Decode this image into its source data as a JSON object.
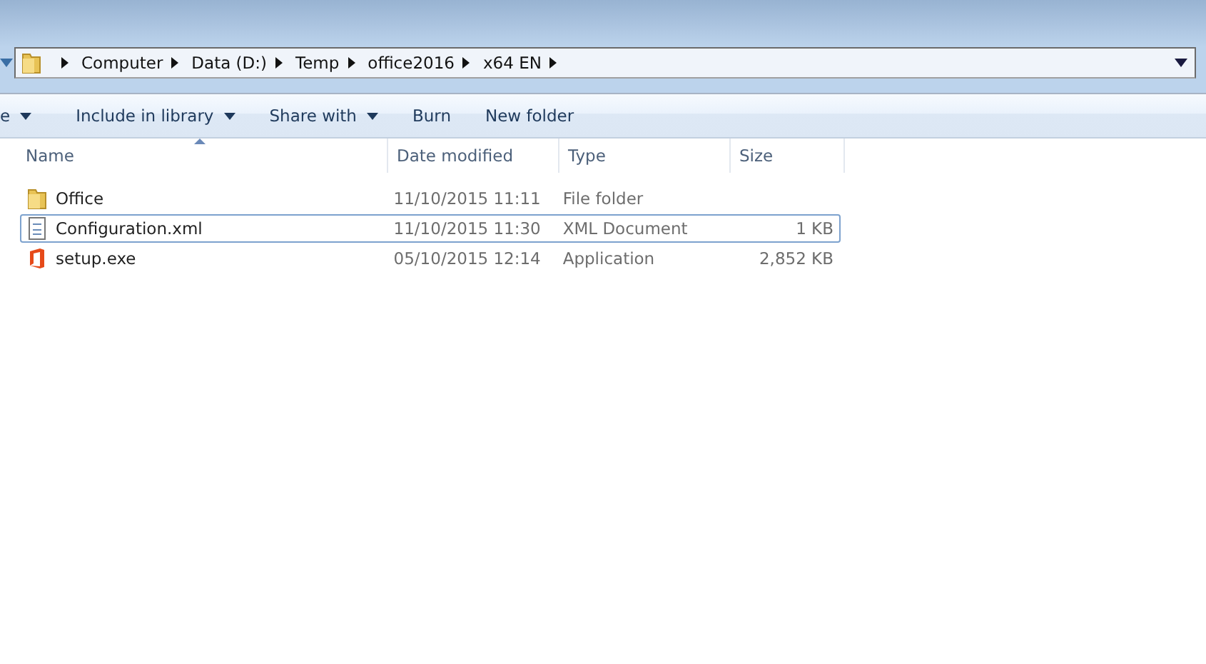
{
  "address_bar": {
    "crumbs": [
      "Computer",
      "Data (D:)",
      "Temp",
      "office2016",
      "x64 EN"
    ]
  },
  "toolbar": {
    "items": [
      {
        "label": "e",
        "dropdown": true
      },
      {
        "label": "Include in library",
        "dropdown": true
      },
      {
        "label": "Share with",
        "dropdown": true
      },
      {
        "label": "Burn",
        "dropdown": false
      },
      {
        "label": "New folder",
        "dropdown": false
      }
    ]
  },
  "table": {
    "columns": [
      {
        "label": "Name",
        "sorted": true
      },
      {
        "label": "Date modified",
        "sorted": false
      },
      {
        "label": "Type",
        "sorted": false
      },
      {
        "label": "Size",
        "sorted": false
      }
    ],
    "rows": [
      {
        "kind": "folder",
        "name": "Office",
        "date": "11/10/2015 11:11",
        "type": "File folder",
        "focused": false
      },
      {
        "kind": "xml",
        "name": "Configuration.xml",
        "date": "11/10/2015 11:30",
        "type": "XML Document",
        "size": "1 KB",
        "focused": true
      },
      {
        "kind": "office",
        "name": "setup.exe",
        "date": "05/10/2015 12:14",
        "type": "Application",
        "size": "2,852 KB",
        "focused": false
      }
    ]
  }
}
